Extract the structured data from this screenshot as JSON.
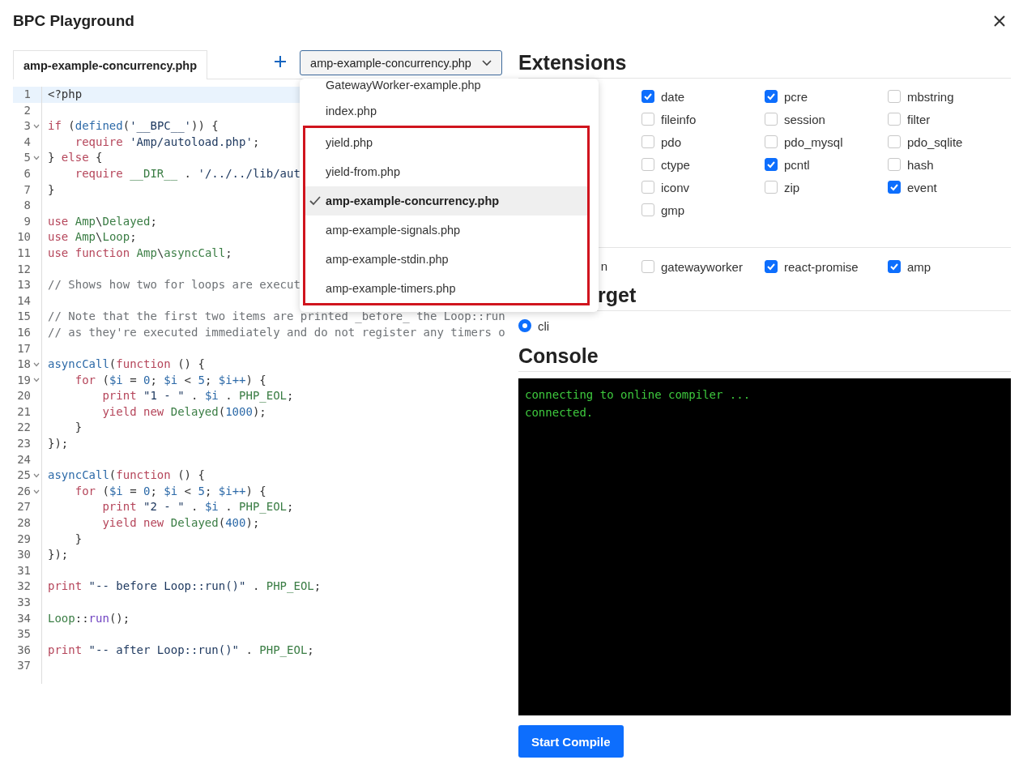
{
  "dialog": {
    "title": "BPC Playground"
  },
  "editor": {
    "tabs": [
      {
        "label": "amp-example-concurrency.php",
        "selected": true
      }
    ],
    "file_select": {
      "value": "amp-example-concurrency.php",
      "expanded": true,
      "options": [
        {
          "label": "GatewayWorker-example.php",
          "selected": false,
          "highlighted": false
        },
        {
          "label": "index.php",
          "selected": false,
          "highlighted": false
        },
        {
          "label": "yield.php",
          "selected": false,
          "highlighted": true
        },
        {
          "label": "yield-from.php",
          "selected": false,
          "highlighted": true
        },
        {
          "label": "amp-example-concurrency.php",
          "selected": true,
          "highlighted": true
        },
        {
          "label": "amp-example-signals.php",
          "selected": false,
          "highlighted": true
        },
        {
          "label": "amp-example-stdin.php",
          "selected": false,
          "highlighted": true
        },
        {
          "label": "amp-example-timers.php",
          "selected": false,
          "highlighted": true
        }
      ]
    },
    "lines": [
      {
        "number": "1",
        "active": true,
        "foldable": false,
        "tokens": [
          {
            "kind": "plain",
            "text": "<?php"
          }
        ]
      },
      {
        "number": "2",
        "active": false,
        "foldable": false
      },
      {
        "number": "3",
        "active": false,
        "foldable": true,
        "tokens": [
          {
            "kind": "keyword",
            "text": "if"
          },
          {
            "kind": "plain",
            "text": " ("
          },
          {
            "kind": "function",
            "text": "defined"
          },
          {
            "kind": "plain",
            "text": "("
          },
          {
            "kind": "string",
            "text": "'__BPC__'"
          },
          {
            "kind": "plain",
            "text": ")) {"
          }
        ]
      },
      {
        "number": "4",
        "active": false,
        "foldable": false,
        "tokens": [
          {
            "kind": "keyword",
            "text": "    require "
          },
          {
            "kind": "string",
            "text": "'Amp/autoload.php'"
          },
          {
            "kind": "plain",
            "text": ";"
          }
        ]
      },
      {
        "number": "5",
        "active": false,
        "foldable": true,
        "tokens": [
          {
            "kind": "plain",
            "text": "} "
          },
          {
            "kind": "keyword",
            "text": "else"
          },
          {
            "kind": "plain",
            "text": " {"
          }
        ]
      },
      {
        "number": "6",
        "active": false,
        "foldable": false,
        "tokens": [
          {
            "kind": "keyword",
            "text": "    require "
          },
          {
            "kind": "constant",
            "text": "__DIR__"
          },
          {
            "kind": "plain",
            "text": " . "
          },
          {
            "kind": "string",
            "text": "'/../../lib/aut"
          }
        ]
      },
      {
        "number": "7",
        "active": false,
        "foldable": false,
        "tokens": [
          {
            "kind": "plain",
            "text": "}"
          }
        ]
      },
      {
        "number": "8",
        "active": false,
        "foldable": false
      },
      {
        "number": "9",
        "active": false,
        "foldable": false,
        "tokens": [
          {
            "kind": "keyword",
            "text": "use "
          },
          {
            "kind": "constant",
            "text": "Amp"
          },
          {
            "kind": "plain",
            "text": "\\"
          },
          {
            "kind": "constant",
            "text": "Delayed"
          },
          {
            "kind": "plain",
            "text": ";"
          }
        ]
      },
      {
        "number": "10",
        "active": false,
        "foldable": false,
        "tokens": [
          {
            "kind": "keyword",
            "text": "use "
          },
          {
            "kind": "constant",
            "text": "Amp"
          },
          {
            "kind": "plain",
            "text": "\\"
          },
          {
            "kind": "constant",
            "text": "Loop"
          },
          {
            "kind": "plain",
            "text": ";"
          }
        ]
      },
      {
        "number": "11",
        "active": false,
        "foldable": false,
        "tokens": [
          {
            "kind": "keyword",
            "text": "use function "
          },
          {
            "kind": "constant",
            "text": "Amp"
          },
          {
            "kind": "plain",
            "text": "\\"
          },
          {
            "kind": "constant",
            "text": "asyncCall"
          },
          {
            "kind": "plain",
            "text": ";"
          }
        ]
      },
      {
        "number": "12",
        "active": false,
        "foldable": false
      },
      {
        "number": "13",
        "active": false,
        "foldable": false,
        "tokens": [
          {
            "kind": "comment",
            "text": "// Shows how two for loops are execut"
          }
        ]
      },
      {
        "number": "14",
        "active": false,
        "foldable": false
      },
      {
        "number": "15",
        "active": false,
        "foldable": false,
        "tokens": [
          {
            "kind": "comment",
            "text": "// Note that the first two items are printed _before_ the Loop::run"
          }
        ]
      },
      {
        "number": "16",
        "active": false,
        "foldable": false,
        "tokens": [
          {
            "kind": "comment",
            "text": "// as they're executed immediately and do not register any timers o"
          }
        ]
      },
      {
        "number": "17",
        "active": false,
        "foldable": false
      },
      {
        "number": "18",
        "active": false,
        "foldable": true,
        "tokens": [
          {
            "kind": "function",
            "text": "asyncCall"
          },
          {
            "kind": "plain",
            "text": "("
          },
          {
            "kind": "keyword",
            "text": "function"
          },
          {
            "kind": "plain",
            "text": " () {"
          }
        ]
      },
      {
        "number": "19",
        "active": false,
        "foldable": true,
        "tokens": [
          {
            "kind": "keyword",
            "text": "    for"
          },
          {
            "kind": "plain",
            "text": " ("
          },
          {
            "kind": "variable",
            "text": "$i"
          },
          {
            "kind": "plain",
            "text": " = "
          },
          {
            "kind": "number",
            "text": "0"
          },
          {
            "kind": "plain",
            "text": "; "
          },
          {
            "kind": "variable",
            "text": "$i"
          },
          {
            "kind": "plain",
            "text": " < "
          },
          {
            "kind": "number",
            "text": "5"
          },
          {
            "kind": "plain",
            "text": "; "
          },
          {
            "kind": "variable",
            "text": "$i++"
          },
          {
            "kind": "plain",
            "text": ") {"
          }
        ]
      },
      {
        "number": "20",
        "active": false,
        "foldable": false,
        "tokens": [
          {
            "kind": "keyword",
            "text": "        print "
          },
          {
            "kind": "string",
            "text": "\"1 - \""
          },
          {
            "kind": "plain",
            "text": " . "
          },
          {
            "kind": "variable",
            "text": "$i"
          },
          {
            "kind": "plain",
            "text": " . "
          },
          {
            "kind": "constant",
            "text": "PHP_EOL"
          },
          {
            "kind": "plain",
            "text": ";"
          }
        ]
      },
      {
        "number": "21",
        "active": false,
        "foldable": false,
        "tokens": [
          {
            "kind": "keyword",
            "text": "        yield new "
          },
          {
            "kind": "constant",
            "text": "Delayed"
          },
          {
            "kind": "plain",
            "text": "("
          },
          {
            "kind": "number",
            "text": "1000"
          },
          {
            "kind": "plain",
            "text": ");"
          }
        ]
      },
      {
        "number": "22",
        "active": false,
        "foldable": false,
        "tokens": [
          {
            "kind": "plain",
            "text": "    }"
          }
        ]
      },
      {
        "number": "23",
        "active": false,
        "foldable": false,
        "tokens": [
          {
            "kind": "plain",
            "text": "});"
          }
        ]
      },
      {
        "number": "24",
        "active": false,
        "foldable": false
      },
      {
        "number": "25",
        "active": false,
        "foldable": true,
        "tokens": [
          {
            "kind": "function",
            "text": "asyncCall"
          },
          {
            "kind": "plain",
            "text": "("
          },
          {
            "kind": "keyword",
            "text": "function"
          },
          {
            "kind": "plain",
            "text": " () {"
          }
        ]
      },
      {
        "number": "26",
        "active": false,
        "foldable": true,
        "tokens": [
          {
            "kind": "keyword",
            "text": "    for"
          },
          {
            "kind": "plain",
            "text": " ("
          },
          {
            "kind": "variable",
            "text": "$i"
          },
          {
            "kind": "plain",
            "text": " = "
          },
          {
            "kind": "number",
            "text": "0"
          },
          {
            "kind": "plain",
            "text": "; "
          },
          {
            "kind": "variable",
            "text": "$i"
          },
          {
            "kind": "plain",
            "text": " < "
          },
          {
            "kind": "number",
            "text": "5"
          },
          {
            "kind": "plain",
            "text": "; "
          },
          {
            "kind": "variable",
            "text": "$i++"
          },
          {
            "kind": "plain",
            "text": ") {"
          }
        ]
      },
      {
        "number": "27",
        "active": false,
        "foldable": false,
        "tokens": [
          {
            "kind": "keyword",
            "text": "        print "
          },
          {
            "kind": "string",
            "text": "\"2 - \""
          },
          {
            "kind": "plain",
            "text": " . "
          },
          {
            "kind": "variable",
            "text": "$i"
          },
          {
            "kind": "plain",
            "text": " . "
          },
          {
            "kind": "constant",
            "text": "PHP_EOL"
          },
          {
            "kind": "plain",
            "text": ";"
          }
        ]
      },
      {
        "number": "28",
        "active": false,
        "foldable": false,
        "tokens": [
          {
            "kind": "keyword",
            "text": "        yield new "
          },
          {
            "kind": "constant",
            "text": "Delayed"
          },
          {
            "kind": "plain",
            "text": "("
          },
          {
            "kind": "number",
            "text": "400"
          },
          {
            "kind": "plain",
            "text": ");"
          }
        ]
      },
      {
        "number": "29",
        "active": false,
        "foldable": false,
        "tokens": [
          {
            "kind": "plain",
            "text": "    }"
          }
        ]
      },
      {
        "number": "30",
        "active": false,
        "foldable": false,
        "tokens": [
          {
            "kind": "plain",
            "text": "});"
          }
        ]
      },
      {
        "number": "31",
        "active": false,
        "foldable": false
      },
      {
        "number": "32",
        "active": false,
        "foldable": false,
        "tokens": [
          {
            "kind": "keyword",
            "text": "print "
          },
          {
            "kind": "string",
            "text": "\"-- before Loop::run()\""
          },
          {
            "kind": "plain",
            "text": " . "
          },
          {
            "kind": "constant",
            "text": "PHP_EOL"
          },
          {
            "kind": "plain",
            "text": ";"
          }
        ]
      },
      {
        "number": "33",
        "active": false,
        "foldable": false
      },
      {
        "number": "34",
        "active": false,
        "foldable": false,
        "tokens": [
          {
            "kind": "constant",
            "text": "Loop"
          },
          {
            "kind": "plain",
            "text": "::"
          },
          {
            "kind": "method",
            "text": "run"
          },
          {
            "kind": "plain",
            "text": "();"
          }
        ]
      },
      {
        "number": "35",
        "active": false,
        "foldable": false
      },
      {
        "number": "36",
        "active": false,
        "foldable": false,
        "tokens": [
          {
            "kind": "keyword",
            "text": "print "
          },
          {
            "kind": "string",
            "text": "\"-- after Loop::run()\""
          },
          {
            "kind": "plain",
            "text": " . "
          },
          {
            "kind": "constant",
            "text": "PHP_EOL"
          },
          {
            "kind": "plain",
            "text": ";"
          }
        ]
      },
      {
        "number": "37",
        "active": false,
        "foldable": false
      }
    ]
  },
  "extensions": {
    "heading": "Extensions",
    "items": [
      {
        "label": "date",
        "checked": true
      },
      {
        "label": "pcre",
        "checked": true
      },
      {
        "label": "mbstring",
        "checked": false
      },
      {
        "label": "fileinfo",
        "checked": false
      },
      {
        "label": "session",
        "checked": false
      },
      {
        "label": "filter",
        "checked": false
      },
      {
        "label": "pdo",
        "checked": false
      },
      {
        "label": "pdo_mysql",
        "checked": false
      },
      {
        "label": "pdo_sqlite",
        "checked": false
      },
      {
        "label": "ctype",
        "checked": false
      },
      {
        "label": "pcntl",
        "checked": true
      },
      {
        "label": "hash",
        "checked": false
      },
      {
        "label": "iconv",
        "checked": false
      },
      {
        "label": "zip",
        "checked": false
      },
      {
        "label": "event",
        "checked": true
      },
      {
        "label": "gmp",
        "checked": false
      }
    ]
  },
  "packages": {
    "partial_label": "n",
    "items": [
      {
        "label": "gatewayworker",
        "checked": false
      },
      {
        "label": "react-promise",
        "checked": true
      },
      {
        "label": "amp",
        "checked": true
      }
    ]
  },
  "target": {
    "heading": "rget",
    "options": [
      {
        "label": "cli",
        "selected": true
      }
    ]
  },
  "console": {
    "heading": "Console",
    "lines": [
      "connecting to online compiler ...",
      "connected."
    ]
  },
  "compile_button": "Start Compile"
}
